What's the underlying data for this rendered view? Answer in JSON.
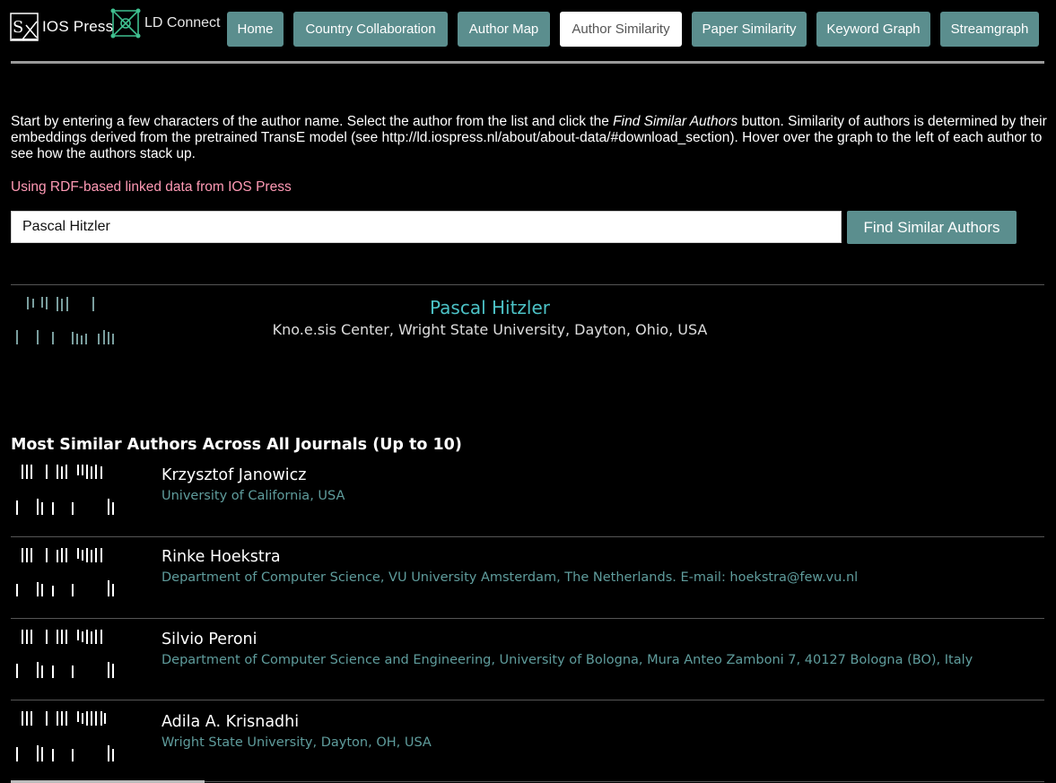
{
  "header": {
    "ios_logo_text": "IOS Press",
    "ld_logo_text": "LD Connect",
    "nav": [
      {
        "label": "Home",
        "active": false
      },
      {
        "label": "Country Collaboration",
        "active": false
      },
      {
        "label": "Author Map",
        "active": false
      },
      {
        "label": "Author Similarity",
        "active": true
      },
      {
        "label": "Paper Similarity",
        "active": false
      },
      {
        "label": "Keyword Graph",
        "active": false
      },
      {
        "label": "Streamgraph",
        "active": false
      }
    ]
  },
  "intro": {
    "before": "Start by entering a few characters of the author name. Select the author from the list and click the ",
    "emphasis": "Find Similar Authors",
    "after": " button. Similarity of authors is determined by their embeddings derived from the pretrained TransE model (see http://ld.iospress.nl/about/about-data/#download_section). Hover over the graph to the left of each author to see how the authors stack up."
  },
  "rdf_note": "Using RDF-based linked data from IOS Press",
  "search": {
    "value": "Pascal Hitzler",
    "button_label": "Find Similar Authors"
  },
  "selected_author": {
    "name": "Pascal Hitzler",
    "affiliation": "Kno.e.sis Center, Wright State University, Dayton, Ohio, USA"
  },
  "similar_section_title": "Most Similar Authors Across All Journals (Up to 10)",
  "similar_authors": [
    {
      "name": "Krzysztof Janowicz",
      "affiliation": "University of California, USA"
    },
    {
      "name": "Rinke Hoekstra",
      "affiliation": "Department of Computer Science, VU University Amsterdam, The Netherlands. E-mail: hoekstra@few.vu.nl"
    },
    {
      "name": "Silvio Peroni",
      "affiliation": "Department of Computer Science and Engineering, University of Bologna, Mura Anteo Zamboni 7, 40127 Bologna (BO), Italy"
    },
    {
      "name": "Adila A. Krisnadhi",
      "affiliation": "Wright State University, Dayton, OH, USA"
    }
  ],
  "colors": {
    "accent": "#5b8e8e",
    "selected_name": "#4cc2c6",
    "affiliation": "#5f9c9c",
    "note": "#ff9ab5",
    "selected_bars": "#7a9e9e",
    "similar_bars": "#ffffff"
  }
}
